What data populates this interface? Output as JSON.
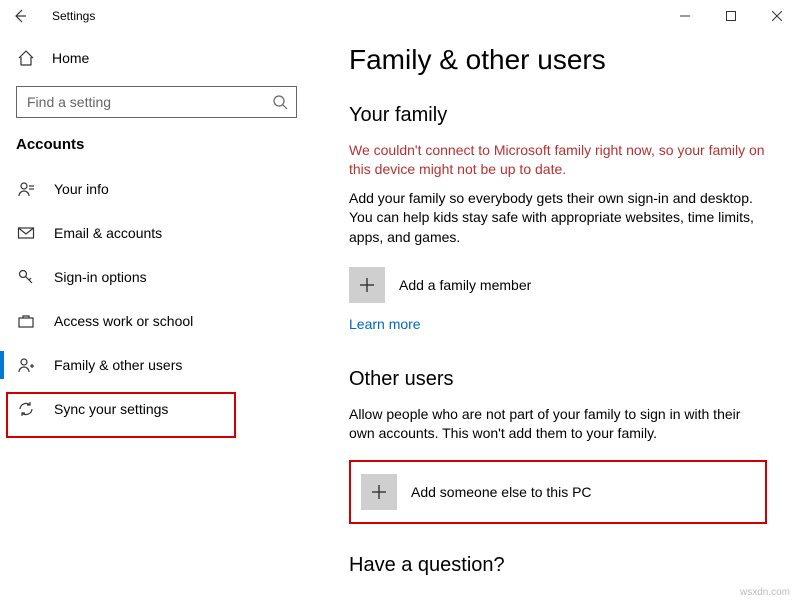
{
  "titlebar": {
    "app_title": "Settings"
  },
  "sidebar": {
    "home_label": "Home",
    "search_placeholder": "Find a setting",
    "section_label": "Accounts",
    "items": [
      {
        "label": "Your info"
      },
      {
        "label": "Email & accounts"
      },
      {
        "label": "Sign-in options"
      },
      {
        "label": "Access work or school"
      },
      {
        "label": "Family & other users"
      },
      {
        "label": "Sync your settings"
      }
    ]
  },
  "main": {
    "page_title": "Family & other users",
    "family": {
      "heading": "Your family",
      "error_text": "We couldn't connect to Microsoft family right now, so your family on this device might not be up to date.",
      "body_text": "Add your family so everybody gets their own sign-in and desktop. You can help kids stay safe with appropriate websites, time limits, apps, and games.",
      "add_label": "Add a family member",
      "learn_more": "Learn more"
    },
    "other": {
      "heading": "Other users",
      "body_text": "Allow people who are not part of your family to sign in with their own accounts. This won't add them to your family.",
      "add_label": "Add someone else to this PC"
    },
    "question_heading": "Have a question?"
  },
  "watermark": "wsxdn.com"
}
